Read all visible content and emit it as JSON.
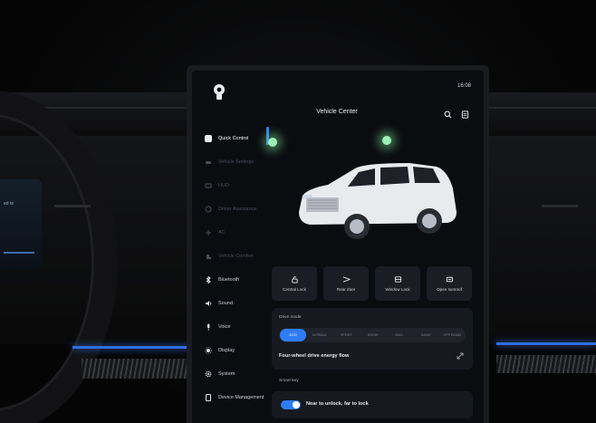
{
  "status_bar": {
    "time": "16:08"
  },
  "header": {
    "title": "Vehicle Center"
  },
  "sidebar": {
    "items": [
      {
        "label": "Quick Control",
        "state": "active",
        "icon": "quick-control-icon"
      },
      {
        "label": "Vehicle Settings",
        "state": "dim",
        "icon": "vehicle-settings-icon"
      },
      {
        "label": "HUD",
        "state": "dim",
        "icon": "hud-icon"
      },
      {
        "label": "Driver Assistance",
        "state": "dim",
        "icon": "driver-assistance-icon"
      },
      {
        "label": "AC",
        "state": "dim",
        "icon": "ac-icon"
      },
      {
        "label": "Vehicle Comfort",
        "state": "dim",
        "icon": "vehicle-comfort-icon"
      },
      {
        "label": "Bluetooth",
        "state": "normal",
        "icon": "bluetooth-icon"
      },
      {
        "label": "Sound",
        "state": "normal",
        "icon": "sound-icon"
      },
      {
        "label": "Voice",
        "state": "normal",
        "icon": "voice-icon"
      },
      {
        "label": "Display",
        "state": "normal",
        "icon": "display-icon"
      },
      {
        "label": "System",
        "state": "normal",
        "icon": "system-icon"
      },
      {
        "label": "Device Management",
        "state": "normal",
        "icon": "device-management-icon"
      }
    ]
  },
  "quick_buttons": [
    {
      "label": "Central Lock",
      "icon": "central-lock-icon"
    },
    {
      "label": "Rear door",
      "icon": "rear-door-icon"
    },
    {
      "label": "Window Lock",
      "icon": "window-lock-icon"
    },
    {
      "label": "Open sunroof",
      "icon": "sunroof-icon"
    }
  ],
  "drive_mode": {
    "title": "Drive mode",
    "modes": [
      "ECO",
      "NORMAL",
      "SPORT",
      "SNOW",
      "MUD",
      "SAND",
      "OFF ROAD"
    ],
    "selected": "ECO",
    "energy_flow": "Four-wheel drive energy flow"
  },
  "smart_key": {
    "label": "Smart key",
    "option": "Near to unlock, far to lock",
    "enabled": true
  },
  "cluster": {
    "text": "ed to"
  },
  "colors": {
    "accent": "#2f7df6",
    "background": "#0b0c10",
    "card": "#171920",
    "ambient": "#2f6ee0"
  }
}
